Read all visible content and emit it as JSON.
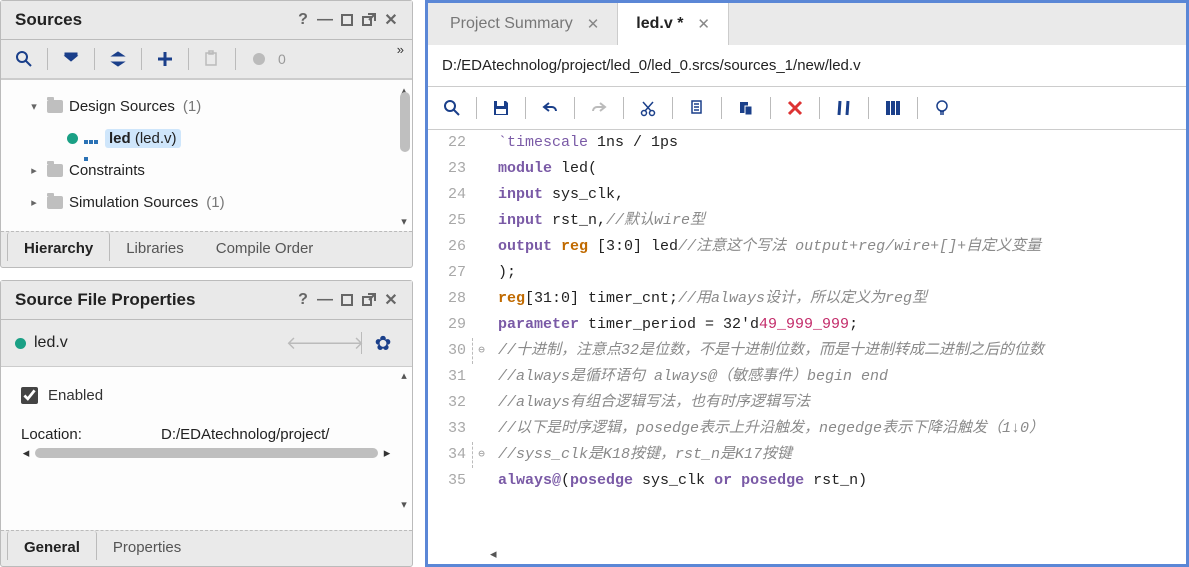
{
  "sources": {
    "title": "Sources",
    "toolbar": {
      "count": "0"
    },
    "tree": {
      "designSources": {
        "label": "Design Sources",
        "count": "(1)"
      },
      "ledFile": {
        "bold": "led",
        "paren": "(led.v)"
      },
      "constraints": {
        "label": "Constraints"
      },
      "simSources": {
        "label": "Simulation Sources",
        "count": "(1)"
      }
    },
    "tabs": {
      "hierarchy": "Hierarchy",
      "libraries": "Libraries",
      "compile": "Compile Order"
    }
  },
  "props": {
    "title": "Source File Properties",
    "file": "led.v",
    "enabled": "Enabled",
    "locationLabel": "Location:",
    "locationValue": "D:/EDAtechnolog/project/",
    "tabs": {
      "general": "General",
      "properties": "Properties"
    }
  },
  "editor": {
    "tabs": {
      "summary": "Project Summary",
      "ledv": "led.v *"
    },
    "path": "D:/EDAtechnolog/project/led_0/led_0.srcs/sources_1/new/led.v"
  },
  "code": {
    "lines": [
      {
        "n": 22,
        "html": "<span class='c-dir'>`timescale</span><span class='c-txt'> 1ns / 1ps</span>"
      },
      {
        "n": 23,
        "html": "<span class='c-kw'>module</span><span class='c-txt'> led(</span>"
      },
      {
        "n": 24,
        "html": "<span class='c-kw'>input</span><span class='c-txt'> sys_clk,</span>"
      },
      {
        "n": 25,
        "html": "<span class='c-kw'>input</span><span class='c-txt'> rst_n,</span><span class='c-com'>//默认wire型</span>"
      },
      {
        "n": 26,
        "html": "<span class='c-kw'>output</span><span class='c-txt'> </span><span class='c-ty'>reg</span><span class='c-txt'> [3:0] led</span><span class='c-com'>//注意这个写法 output+reg/wire+[]+自定义变量</span>"
      },
      {
        "n": 27,
        "html": "<span class='c-txt'>);</span>"
      },
      {
        "n": 28,
        "html": "<span class='c-ty'>reg</span><span class='c-txt'>[31:0] timer_cnt;</span><span class='c-com'>//用always设计，所以定义为reg型</span>"
      },
      {
        "n": 29,
        "html": "<span class='c-kw'>parameter</span><span class='c-txt'> timer_period = 32'd</span><span class='c-num'>49_999_999</span><span class='c-txt'>;</span>"
      },
      {
        "n": 30,
        "fold": "⊖",
        "html": "<span class='c-com'>//十进制，注意点32是位数，不是十进制位数，而是十进制转成二进制之后的位数</span>"
      },
      {
        "n": 31,
        "html": "<span class='c-com'>//always是循环语句 always@（敏感事件）begin end</span>"
      },
      {
        "n": 32,
        "html": "<span class='c-com'>//always有组合逻辑写法，也有时序逻辑写法</span>"
      },
      {
        "n": 33,
        "html": "<span class='c-com'>//以下是时序逻辑，posedge表示上升沿触发，negedge表示下降沿触发（1↓0）</span>"
      },
      {
        "n": 34,
        "fold": "⊖",
        "html": "<span class='c-com'>//syss_clk是K18按键，rst_n是K17按键</span>"
      },
      {
        "n": 35,
        "html": "<span class='c-kw'>always@</span><span class='c-txt'>(</span><span class='c-kw'>posedge</span><span class='c-txt'> sys_clk </span><span class='c-kw'>or</span><span class='c-txt'> </span><span class='c-kw'>posedge</span><span class='c-txt'> rst_n)</span>"
      }
    ]
  }
}
